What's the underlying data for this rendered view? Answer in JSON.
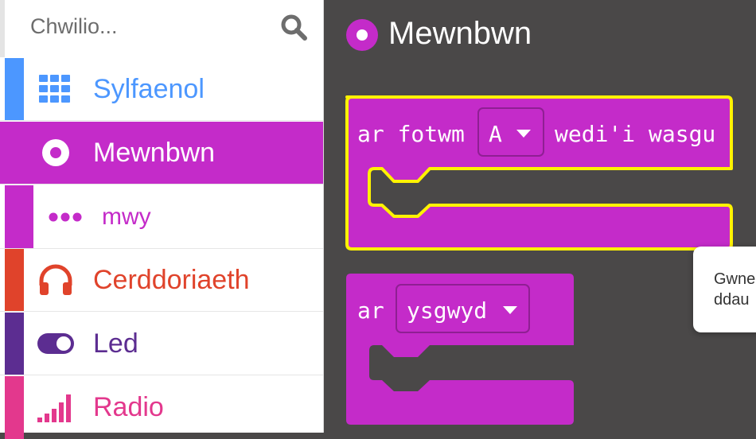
{
  "search": {
    "placeholder": "Chwilio..."
  },
  "categories": [
    {
      "label": "Sylfaenol",
      "color": "#4c97ff",
      "icon": "grid-icon"
    },
    {
      "label": "Mewnbwn",
      "color": "#c42bc9",
      "icon": "radio-button-icon",
      "selected": true
    },
    {
      "label": "mwy",
      "color": "#c42bc9",
      "icon": "more-dots-icon"
    },
    {
      "label": "Cerddoriaeth",
      "color": "#e0432b",
      "icon": "headphones-icon"
    },
    {
      "label": "Led",
      "color": "#5c2d91",
      "icon": "toggle-icon"
    },
    {
      "label": "Radio",
      "color": "#e3388d",
      "icon": "signal-bars-icon"
    }
  ],
  "flyout": {
    "title": "Mewnbwn",
    "block1": {
      "prefix": "ar fotwm",
      "dropdown": "A",
      "suffix": "wedi'i wasgu"
    },
    "block2": {
      "prefix": "ar",
      "dropdown": "ysgwyd"
    }
  },
  "tooltip": {
    "line1": "Gwnе",
    "line2": "ddau"
  },
  "colors": {
    "input": "#c42bc9",
    "highlight": "#fff200",
    "canvas": "#4a4848"
  }
}
